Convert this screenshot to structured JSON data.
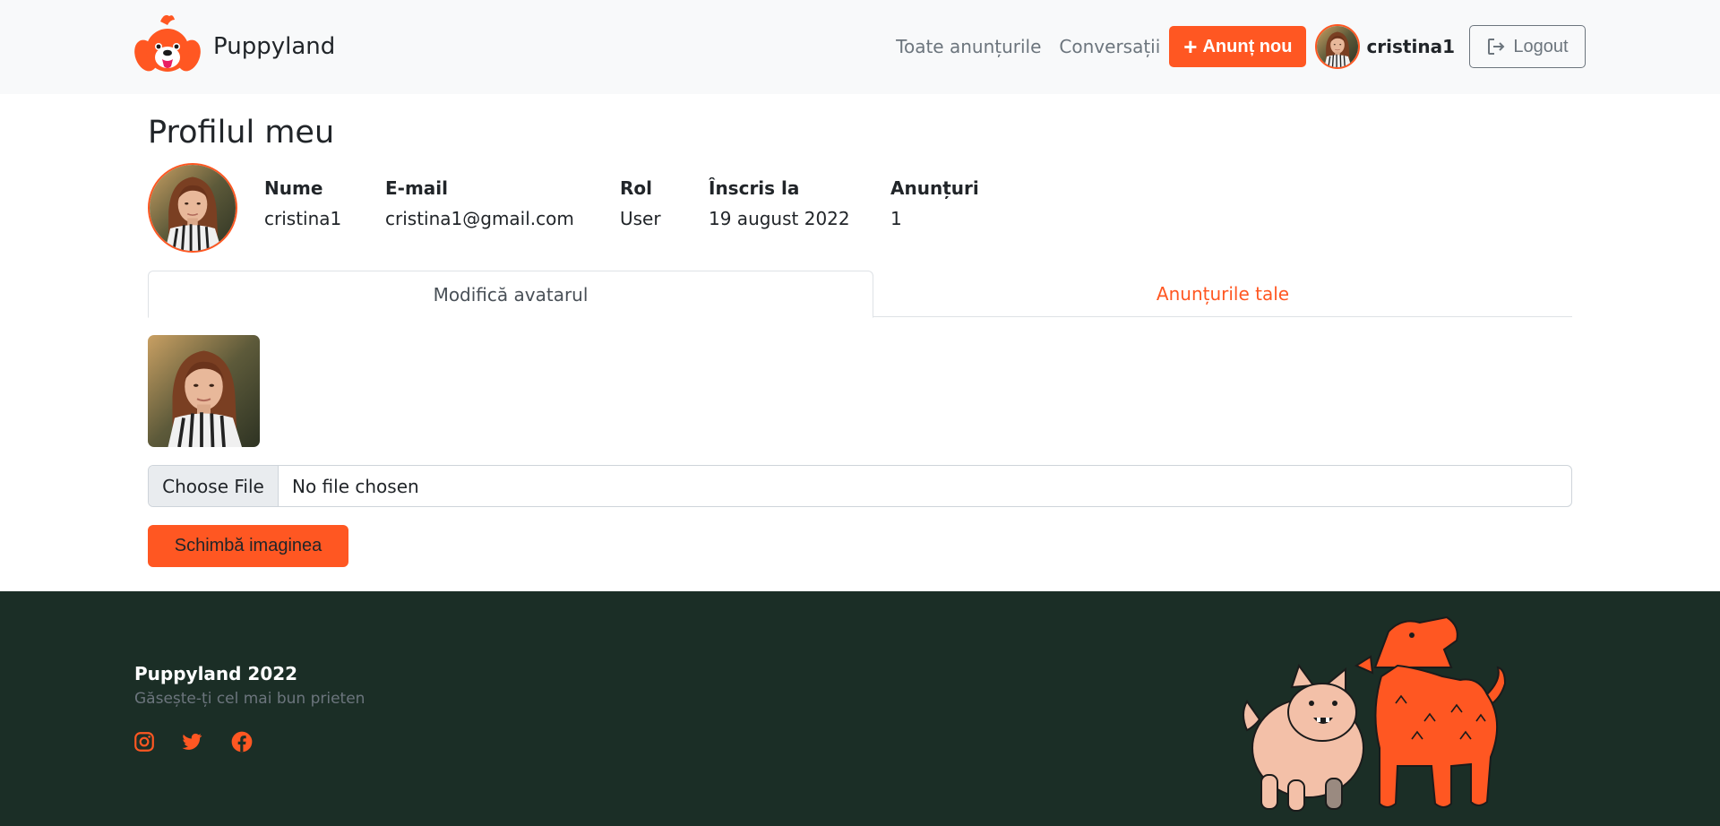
{
  "brand": {
    "name": "Puppyland"
  },
  "nav": {
    "all_ads": "Toate anunțurile",
    "conversations": "Conversații",
    "new_ad": "Anunț nou",
    "username": "cristina1",
    "logout": "Logout"
  },
  "profile": {
    "title": "Profilul meu",
    "fields": [
      {
        "label": "Nume",
        "value": "cristina1"
      },
      {
        "label": "E-mail",
        "value": "cristina1@gmail.com"
      },
      {
        "label": "Rol",
        "value": "User"
      },
      {
        "label": "Înscris la",
        "value": "19 august 2022"
      },
      {
        "label": "Anunțuri",
        "value": "1"
      }
    ]
  },
  "tabs": {
    "change_avatar": "Modifică avatarul",
    "your_ads": "Anunțurile tale"
  },
  "upload": {
    "choose_file": "Choose File",
    "no_file": "No file chosen",
    "submit": "Schimbă imaginea"
  },
  "footer": {
    "title": "Puppyland 2022",
    "tagline": "Găsește-ți cel mai bun prieten",
    "social": [
      "instagram-icon",
      "twitter-icon",
      "facebook-icon"
    ]
  },
  "colors": {
    "accent": "#ff5722",
    "navbar_bg": "#f8f9fa",
    "footer_bg": "#1b2e26",
    "muted": "#6c757d"
  }
}
